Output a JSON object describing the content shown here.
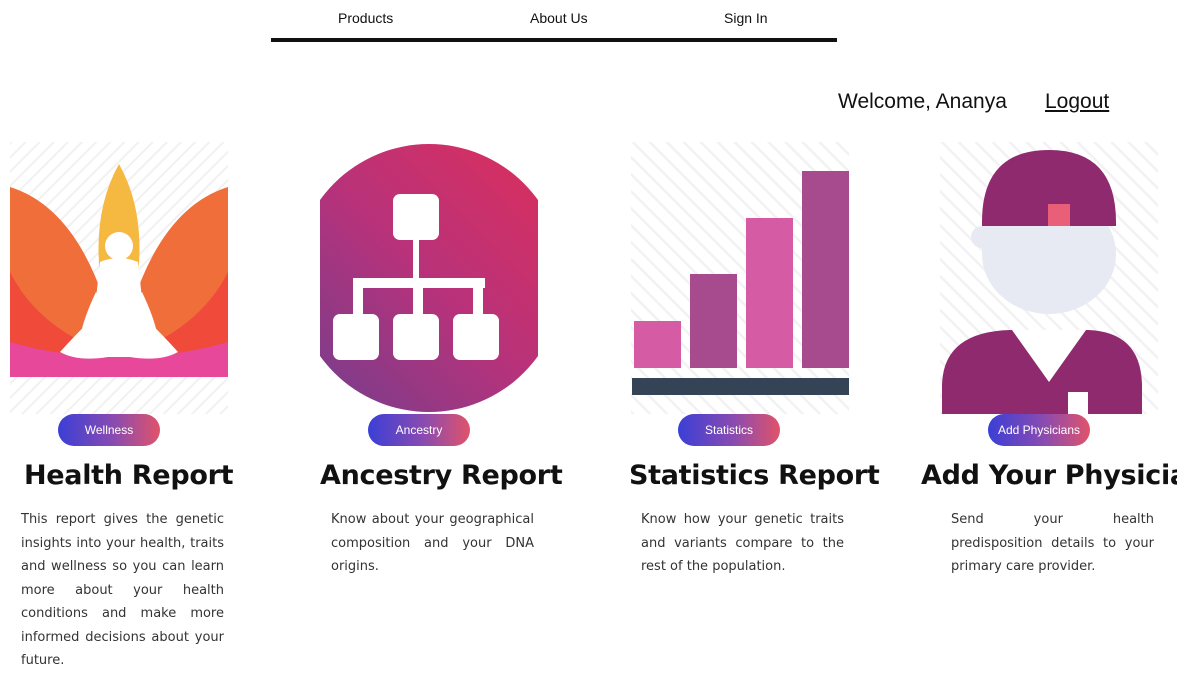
{
  "nav": {
    "items": [
      "Products",
      "About Us",
      "Sign In"
    ]
  },
  "header": {
    "welcome": "Welcome, Ananya",
    "logout": "Logout"
  },
  "cards": [
    {
      "badge": "Wellness",
      "title": "Health Report",
      "description": "This report gives the genetic insights into your health, traits and wellness so you can learn more about your health conditions and make more informed decisions about your future."
    },
    {
      "badge": "Ancestry",
      "title": "Ancestry Report",
      "description": "Know about your geographical composition and your DNA origins."
    },
    {
      "badge": "Statistics",
      "title": "Statistics Report",
      "description": "Know how your genetic traits and variants compare to the rest of the population."
    },
    {
      "badge": "Add Physicians",
      "title": "Add Your Physician",
      "description": "Send your health predisposition details to your primary care provider."
    }
  ],
  "colors": {
    "pill_start": "#3b3fd6",
    "pill_end": "#e0536a",
    "magenta": "#9b2a74",
    "pink": "#d45ba4"
  },
  "icons": [
    "meditation-lotus-illustration",
    "hierarchy-chart-icon",
    "bar-chart-icon",
    "physician-avatar-icon"
  ]
}
